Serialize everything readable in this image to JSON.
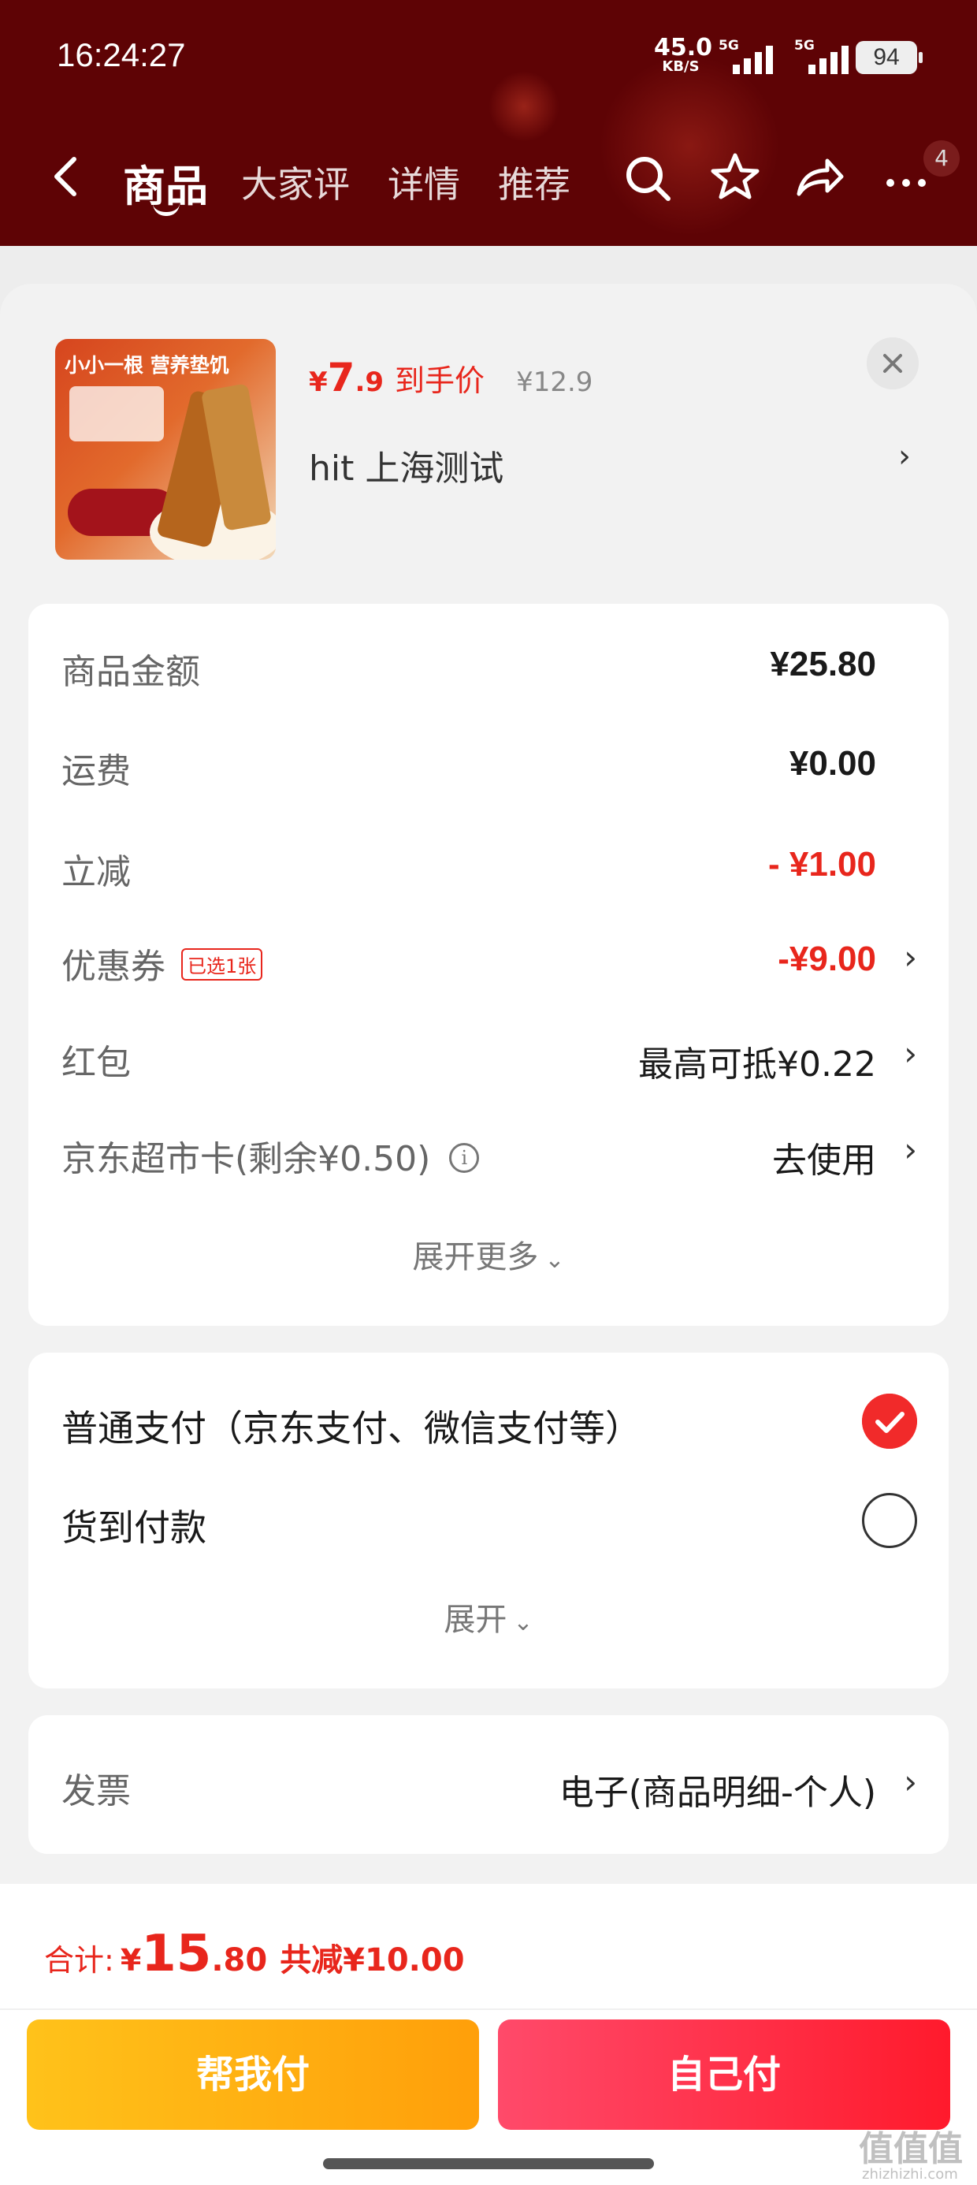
{
  "status_bar": {
    "time": "16:24:27",
    "net_speed": "45.0",
    "net_unit": "KB/S",
    "sig1_label": "5G",
    "sig2_label": "5G",
    "battery": "94"
  },
  "nav": {
    "tabs": [
      "商品",
      "大家评",
      "详情",
      "推荐"
    ],
    "active_tab": 0,
    "badge": "4"
  },
  "product": {
    "image_text": "小小一根 营养垫饥",
    "price_yen": "¥",
    "price_int": "7",
    "price_dec": ".9",
    "price_label": "到手价",
    "original_price": "¥12.9",
    "sku": "hit  上海测试"
  },
  "costs": {
    "goods_label": "商品金额",
    "goods_value": "¥25.80",
    "freight_label": "运费",
    "freight_value": "¥0.00",
    "discount_label": "立减",
    "discount_value": "- ¥1.00",
    "coupon_label": "优惠券",
    "coupon_tag": "已选1张",
    "coupon_value": "-¥9.00",
    "redpacket_label": "红包",
    "redpacket_value": "最高可抵¥0.22",
    "card_label": "京东超市卡(剩余¥0.50)",
    "card_info": "i",
    "card_value": "去使用",
    "expand_more": "展开更多"
  },
  "payment": {
    "normal_label": "普通支付（京东支付、微信支付等）",
    "normal_selected": true,
    "cod_label": "货到付款",
    "cod_selected": false,
    "expand": "展开"
  },
  "invoice": {
    "label": "发票",
    "value": "电子(商品明细-个人)"
  },
  "footer": {
    "total_label": "合计:",
    "total_yen": "¥",
    "total_int": "15",
    "total_dec": ".80",
    "total_save": "共减¥10.00",
    "help_pay": "帮我付",
    "self_pay": "自己付"
  },
  "watermark": {
    "main": "值值值",
    "sub": "zhizhizhi.com"
  },
  "colors": {
    "header_bg": "#5e0305",
    "accent_red": "#e8261c",
    "help_btn": "#ffb10f",
    "self_btn": "#ff2a40"
  }
}
